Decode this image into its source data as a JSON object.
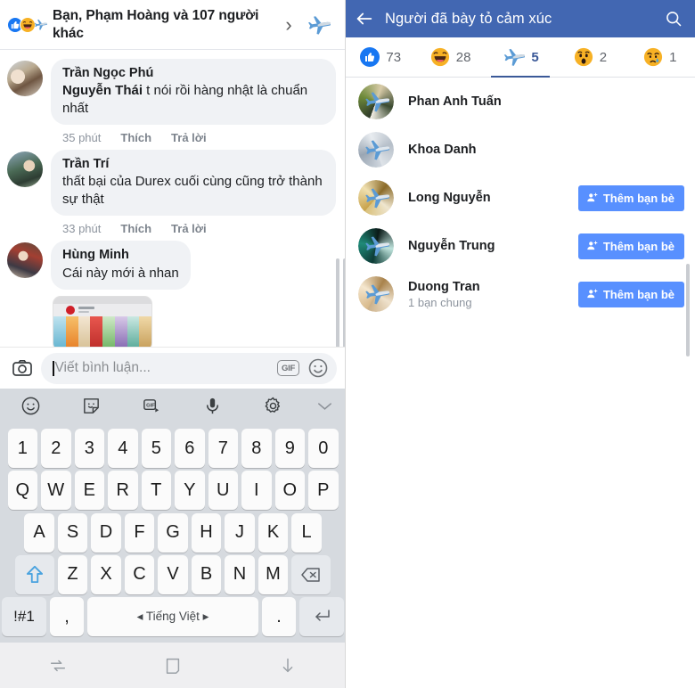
{
  "left": {
    "post_header": {
      "reactions": [
        "like-icon",
        "haha-icon",
        "plane-icon"
      ],
      "title": "Bạn, Phạm Hoàng và 107 người khác",
      "chevron": "›",
      "plane_badge": "plane-icon"
    },
    "comments": [
      {
        "author": "Trần Ngọc Phú",
        "mention": "Nguyễn Thái",
        "text": " t nói rồi hàng nhật là chuẩn nhất",
        "time": "35 phút",
        "like": "Thích",
        "reply": "Trả lời",
        "attachment": null
      },
      {
        "author": "Trần Trí",
        "mention": "",
        "text": "thất bại của Durex cuối cùng cũng trở thành sự thật",
        "time": "33 phút",
        "like": "Thích",
        "reply": "Trả lời",
        "attachment": null
      },
      {
        "author": "Hùng Minh",
        "mention": "",
        "text": "Cái này mới à nhan",
        "time": "",
        "like": "",
        "reply": "",
        "attachment": "photo-thumbnail"
      }
    ],
    "composer": {
      "camera_icon": "camera-icon",
      "placeholder": "Viết bình luận...",
      "gif_label": "GIF",
      "emoji_icon": "smiley-icon"
    },
    "keyboard_toolbar": [
      {
        "icon": "emoji-icon"
      },
      {
        "icon": "sticker-icon"
      },
      {
        "icon": "gif-icon"
      },
      {
        "icon": "microphone-icon"
      },
      {
        "icon": "settings-gear-icon"
      },
      {
        "icon": "chevron-down-icon"
      }
    ],
    "keyboard": {
      "row_numbers": [
        "1",
        "2",
        "3",
        "4",
        "5",
        "6",
        "7",
        "8",
        "9",
        "0"
      ],
      "row_top": [
        "Q",
        "W",
        "E",
        "R",
        "T",
        "Y",
        "U",
        "I",
        "O",
        "P"
      ],
      "row_home": [
        "A",
        "S",
        "D",
        "F",
        "G",
        "H",
        "J",
        "K",
        "L"
      ],
      "row_bottom": [
        "Z",
        "X",
        "C",
        "V",
        "B",
        "N",
        "M"
      ],
      "shift_icon": "shift-up-arrow-icon",
      "backspace_icon": "backspace-icon",
      "symbols_key": "!#1",
      "comma_key": ",",
      "space_key": "◂ Tiếng Việt ▸",
      "period_key": ".",
      "enter_icon": "enter-return-icon"
    },
    "navbar": [
      {
        "icon": "recents-icon"
      },
      {
        "icon": "home-square-icon"
      },
      {
        "icon": "hide-keyboard-down-arrow-icon"
      }
    ]
  },
  "right": {
    "appbar": {
      "back_icon": "back-arrow-icon",
      "title": "Người đã bày tỏ cảm xúc",
      "search_icon": "search-icon"
    },
    "tabs": [
      {
        "icon": "like-icon",
        "count": "73",
        "active": false
      },
      {
        "icon": "haha-icon",
        "count": "28",
        "active": false
      },
      {
        "icon": "plane-icon",
        "count": "5",
        "active": true
      },
      {
        "icon": "wow-icon",
        "count": "2",
        "active": false
      },
      {
        "icon": "sad-icon",
        "count": "1",
        "active": false
      }
    ],
    "people": [
      {
        "name": "Phan Anh Tuấn",
        "subtitle": "",
        "action": ""
      },
      {
        "name": "Khoa Danh",
        "subtitle": "",
        "action": ""
      },
      {
        "name": "Long Nguyễn",
        "subtitle": "",
        "action": "Thêm bạn bè"
      },
      {
        "name": "Nguyễn Trung",
        "subtitle": "",
        "action": "Thêm bạn bè"
      },
      {
        "name": "Duong Tran",
        "subtitle": "1 bạn chung",
        "action": "Thêm bạn bè"
      }
    ]
  },
  "colors": {
    "fb_blue": "#4267b2",
    "accent_blue": "#3b5998",
    "button_blue": "#5890ff",
    "like_blue": "#1877f2",
    "bubble_gray": "#f0f2f5",
    "keyboard_gray": "#d6dadf"
  }
}
